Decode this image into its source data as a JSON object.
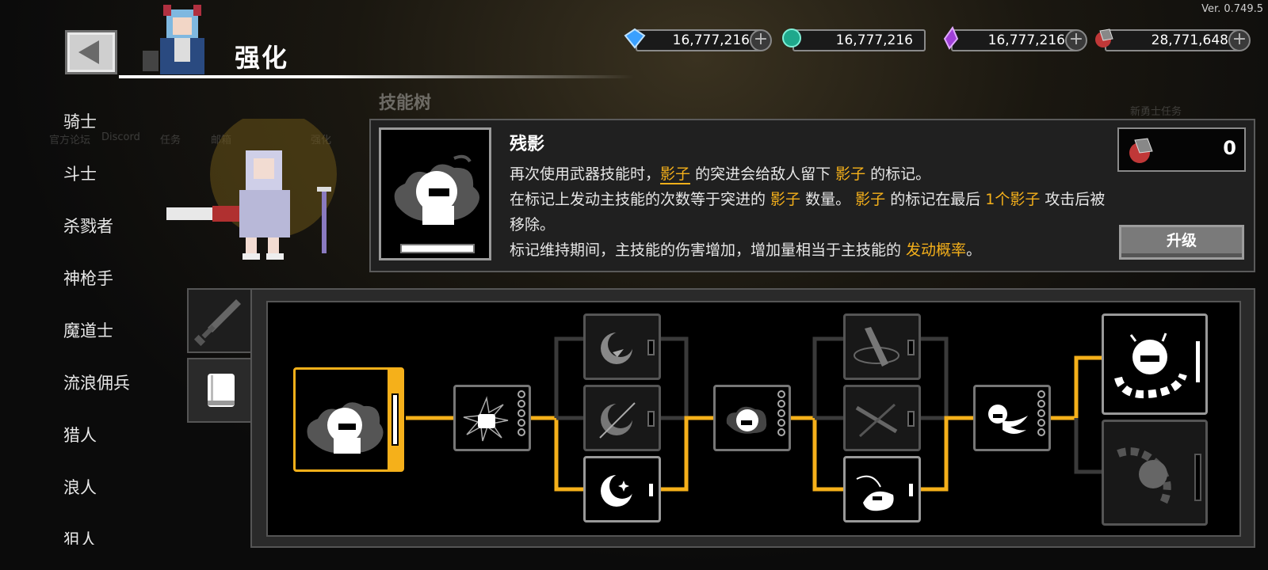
{
  "version": "Ver. 0.749.5",
  "header": {
    "title": "强化",
    "back_label": ""
  },
  "currencies": [
    {
      "name": "gem",
      "value": "16,777,216",
      "color": "#3aa0ff"
    },
    {
      "name": "teal-crystal",
      "value": "16,777,216",
      "color": "#2fd0b0"
    },
    {
      "name": "purple-crystal",
      "value": "16,777,216",
      "color": "#b048e0"
    },
    {
      "name": "ore",
      "value": "28,771,648",
      "color": "#d04040"
    }
  ],
  "background_faded": {
    "nav_labels": [
      "官方论坛",
      "Discord",
      "任务",
      "邮箱",
      "强化"
    ],
    "section_label": "技能树",
    "quest_label": "新勇士任务"
  },
  "class_list": [
    {
      "label": "骑士"
    },
    {
      "label": "斗士"
    },
    {
      "label": "杀戮者"
    },
    {
      "label": "神枪手"
    },
    {
      "label": "魔道士"
    },
    {
      "label": "流浪佣兵"
    },
    {
      "label": "猎人"
    },
    {
      "label": "浪人"
    },
    {
      "label": "狙人"
    }
  ],
  "skill": {
    "name": "残影",
    "desc_line1_a": "再次使用武器技能时，",
    "desc_line1_hl1": "影子",
    "desc_line1_b": " 的突进会给敌人留下 ",
    "desc_line1_hl2": "影子",
    "desc_line1_c": " 的标记。",
    "desc_line2_a": "在标记上发动主技能的次数等于突进的 ",
    "desc_line2_hl1": "影子",
    "desc_line2_b": " 数量。 ",
    "desc_line2_hl2": "影子",
    "desc_line2_c": " 的标记在最后 ",
    "desc_line2_hl3": "1个影子",
    "desc_line2_d": " 攻击后被移除。",
    "desc_line3_a": "标记维持期间，主技能的伤害增加，增加量相当于主技能的 ",
    "desc_line3_hl": "发动概率",
    "desc_line3_b": "。",
    "cost": "0",
    "upgrade_label": "升级"
  },
  "tabs": [
    {
      "name": "weapon",
      "icon": "sword-icon"
    },
    {
      "name": "book",
      "icon": "book-icon",
      "active": true
    }
  ],
  "colors": {
    "accent": "#f5b01a",
    "panel": "#202020"
  }
}
